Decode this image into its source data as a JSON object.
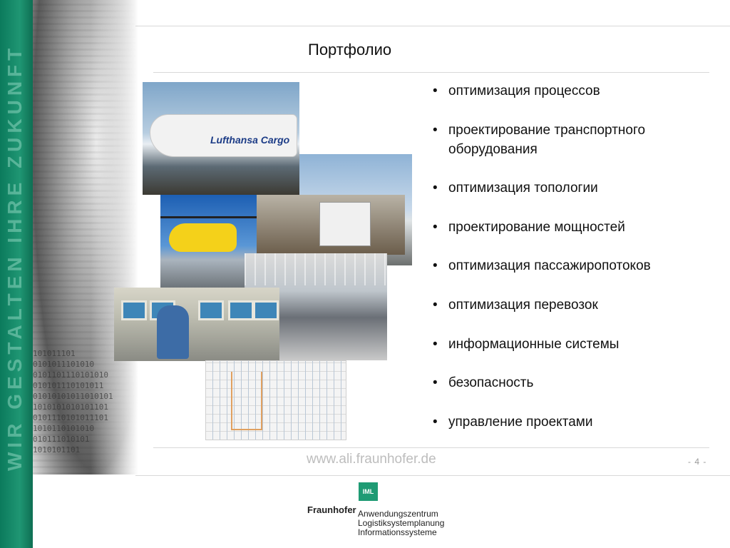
{
  "sidebar": {
    "vertical_text": "WIR GESTALTEN IHRE ZUKUNFT",
    "binary_lines": [
      "101011101",
      "0101011101010",
      "0101101110101010",
      "010101110101011",
      "01010101011010101",
      "1010101010101101",
      "0101110101011101",
      "1010110101010",
      "010111010101",
      "1010101101"
    ]
  },
  "slide": {
    "title": "Портфолио",
    "bullets": [
      "оптимизация процессов",
      "проектирование транспортного оборудования",
      "оптимизация топологии",
      "проектирование мощностей",
      "оптимизация пассажиропотоков",
      "оптимизация перевозок",
      "информационные системы",
      "безопасность",
      "управление проектами"
    ],
    "cargo_label": "Lufthansa Cargo"
  },
  "footer": {
    "url": "www.ali.fraunhofer.de",
    "page_number": "- 4 -"
  },
  "logo": {
    "badge": "IML",
    "brand": "Fraunhofer",
    "institute_lines": [
      "Anwendungszentrum",
      "Logistiksystemplanung",
      "Informationssysteme"
    ]
  }
}
